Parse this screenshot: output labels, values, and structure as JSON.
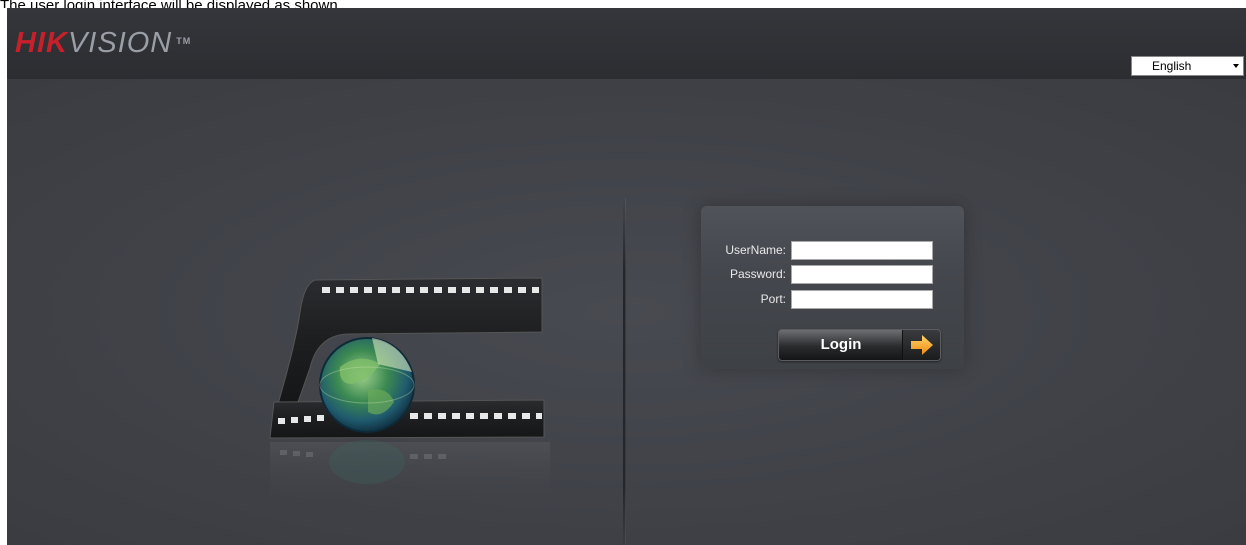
{
  "caption": "The user login interface will be displayed as shown.",
  "header": {
    "logo_text": "HIKVISION",
    "logo_brand_prefix": "HIK",
    "logo_brand_suffix": "VISION",
    "logo_trademark": "TM",
    "language": {
      "selected": "English",
      "options": [
        "English"
      ]
    }
  },
  "login": {
    "fields": [
      {
        "key": "username",
        "label": "UserName:",
        "value": "",
        "placeholder": ""
      },
      {
        "key": "password",
        "label": "Password:",
        "value": "",
        "placeholder": ""
      },
      {
        "key": "port",
        "label": "Port:",
        "value": "",
        "placeholder": ""
      }
    ],
    "login_button_label": "Login"
  },
  "icons": {
    "login_arrow": "arrow-right-icon",
    "hero_art": "film-globe-icon"
  },
  "colors": {
    "brand_red": "#c8202b",
    "brand_grey": "#9a9ea6",
    "background": "#3f4147",
    "arrow_orange": "#f7a21b"
  }
}
